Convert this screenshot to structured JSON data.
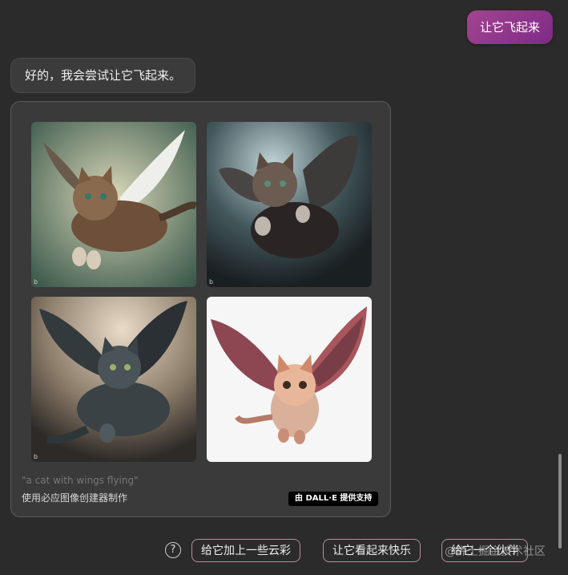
{
  "conversation": {
    "user_message": "让它飞起来",
    "bot_message": "好的，我会尝试让它飞起来。"
  },
  "image_card": {
    "images": [
      {
        "alt": "flying tabby cat with white wings",
        "mark": "b"
      },
      {
        "alt": "flying fluffy cat with grey wings",
        "mark": "b"
      },
      {
        "alt": "flying dark cat with black wings",
        "mark": "b"
      },
      {
        "alt": "cartoon orange cat with red wings",
        "mark": ""
      }
    ],
    "prompt": "\"a cat with wings flying\"",
    "maker": "使用必应图像创建器制作",
    "badge": "由 DALL·E 提供支持"
  },
  "suggestions": {
    "help_icon": "?",
    "chips": [
      "给它加上一些云彩",
      "让它看起来快乐",
      "给它一个伙伴"
    ]
  },
  "watermark": "@稀土掘金技术社区",
  "colors": {
    "accent": "#8e3389",
    "background": "#2b2b2b"
  }
}
